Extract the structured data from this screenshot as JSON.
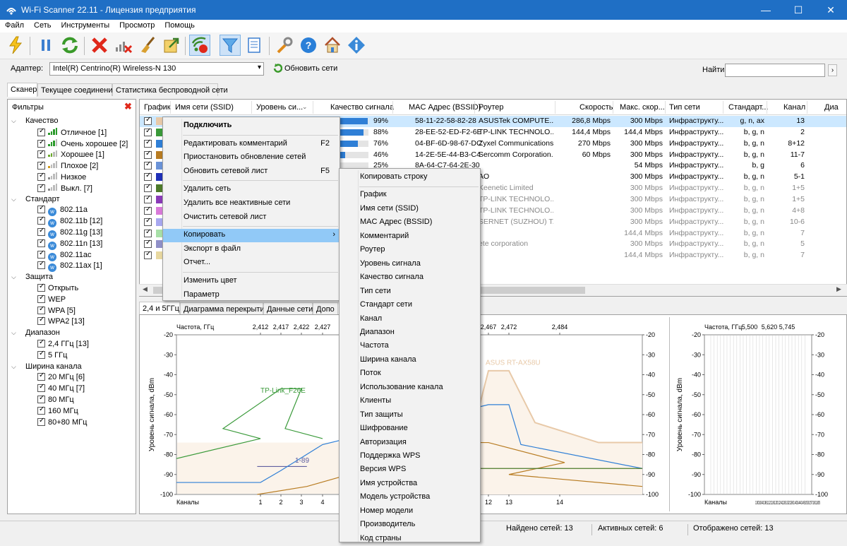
{
  "window": {
    "title": "Wi-Fi Scanner 22.11 - Лицензия предприятия",
    "minimize": "—",
    "maximize": "☐",
    "close": "✕"
  },
  "menu": [
    "Файл",
    "Сеть",
    "Инструменты",
    "Просмотр",
    "Помощь"
  ],
  "adapter": {
    "label": "Адаптер:",
    "value": "Intel(R) Centrino(R) Wireless-N 130",
    "refresh": "Обновить сети",
    "find_label": "Найти:",
    "find_value": ""
  },
  "main_tabs": [
    "Сканер",
    "Текущее соединение",
    "Статистика беспроводной сети"
  ],
  "filters": {
    "title": "Фильтры",
    "groups": [
      {
        "label": "Качество",
        "items": [
          "Отличное [1]",
          "Очень хорошее [2]",
          "Хорошее [1]",
          "Плохое [2]",
          "Низкое",
          "Выкл. [7]"
        ]
      },
      {
        "label": "Стандарт",
        "items": [
          "802.11a",
          "802.11b [12]",
          "802.11g [13]",
          "802.11n [13]",
          "802.11ac",
          "802.11ax [1]"
        ]
      },
      {
        "label": "Защита",
        "items": [
          "Открыть",
          "WEP",
          "WPA [5]",
          "WPA2 [13]"
        ]
      },
      {
        "label": "Диапазон",
        "items": [
          "2,4 ГГц [13]",
          "5 ГГц"
        ]
      },
      {
        "label": "Ширина канала",
        "items": [
          "20 МГц [6]",
          "40 МГц [7]",
          "80 МГц",
          "160 МГц",
          "80+80 МГц"
        ]
      }
    ]
  },
  "grid": {
    "columns": [
      "График",
      "Имя сети (SSID)",
      "Уровень си...",
      "Качество сигнала",
      "MAC Адрес (BSSID)",
      "Роутер",
      "Скорость",
      "Макс. скор...",
      "Тип сети",
      "Стандарт...",
      "Канал",
      "Диа"
    ],
    "rows": [
      {
        "color": "#e8c9a8",
        "quality": "99%",
        "q": 0.99,
        "mac": "58-11-22-58-82-28",
        "router": "ASUSTek COMPUTE...",
        "speed": "286,8 Mbps",
        "max": "300 Mbps",
        "type": "Инфраструкту...",
        "std": "g, n, ax",
        "ch": "13",
        "selected": true
      },
      {
        "color": "#3a9a3a",
        "quality": "88%",
        "q": 0.88,
        "mac": "28-EE-52-ED-F2-6E",
        "router": "TP-LINK TECHNOLO...",
        "speed": "144,4 Mbps",
        "max": "144,4 Mbps",
        "type": "Инфраструкту...",
        "std": "b, g, n",
        "ch": "2"
      },
      {
        "color": "#2f7fd6",
        "quality": "76%",
        "q": 0.76,
        "mac": "04-BF-6D-98-67-DC",
        "router": "Zyxel Communications ...",
        "speed": "270 Mbps",
        "max": "300 Mbps",
        "type": "Инфраструкту...",
        "std": "b, g, n",
        "ch": "8+12"
      },
      {
        "color": "#b87c22",
        "quality": "46%",
        "q": 0.46,
        "mac": "14-2E-5E-44-B3-C4",
        "router": "Sercomm Corporation.",
        "speed": "60 Mbps",
        "max": "300 Mbps",
        "type": "Инфраструкту...",
        "std": "b, g, n",
        "ch": "11-7"
      },
      {
        "color": "#6a93d8",
        "quality": "25%",
        "q": 0.25,
        "mac": "8A-64-C7-64-2E-30",
        "router": "",
        "speed": "",
        "max": "54 Mbps",
        "type": "Инфраструкту...",
        "std": "b, g",
        "ch": "6"
      },
      {
        "color": "#2030b8",
        "quality": "",
        "q": 0,
        "mac": "",
        "router": "AO",
        "speed": "",
        "max": "300 Mbps",
        "type": "Инфраструкту...",
        "std": "b, g, n",
        "ch": "5-1"
      },
      {
        "color": "#4d7a2a",
        "quality": "",
        "q": 0,
        "mac": "",
        "router": "Keenetic Limited",
        "speed": "",
        "max": "300 Mbps",
        "type": "Инфраструкту...",
        "std": "b, g, n",
        "ch": "1+5",
        "gray": true
      },
      {
        "color": "#8a3ab8",
        "quality": "",
        "q": 0,
        "mac": "",
        "router": "TP-LINK TECHNOLO...",
        "speed": "",
        "max": "300 Mbps",
        "type": "Инфраструкту...",
        "std": "b, g, n",
        "ch": "1+5",
        "gray": true
      },
      {
        "color": "#d97ad9",
        "quality": "",
        "q": 0,
        "mac": "",
        "router": "TP-LINK TECHNOLO...",
        "speed": "",
        "max": "300 Mbps",
        "type": "Инфраструкту...",
        "std": "b, g, n",
        "ch": "4+8",
        "gray": true
      },
      {
        "color": "#a8a8f0",
        "quality": "",
        "q": 0,
        "mac": "",
        "router": "SERNET (SUZHOU) T...",
        "speed": "",
        "max": "300 Mbps",
        "type": "Инфраструкту...",
        "std": "b, g, n",
        "ch": "10-6",
        "gray": true
      },
      {
        "color": "#a8e0a8",
        "quality": "",
        "q": 0,
        "mac": "",
        "router": "",
        "speed": "",
        "max": "144,4 Mbps",
        "type": "Инфраструкту...",
        "std": "b, g, n",
        "ch": "7",
        "gray": true
      },
      {
        "color": "#9090c8",
        "quality": "",
        "q": 0,
        "mac": "",
        "router": "ete corporation",
        "speed": "",
        "max": "300 Mbps",
        "type": "Инфраструкту...",
        "std": "b, g, n",
        "ch": "5",
        "gray": true
      },
      {
        "color": "#e8d8a0",
        "quality": "",
        "q": 0,
        "mac": "",
        "router": "",
        "speed": "",
        "max": "144,4 Mbps",
        "type": "Инфраструкту...",
        "std": "b, g, n",
        "ch": "7",
        "gray": true
      }
    ]
  },
  "bottom_tabs": [
    "2,4 и 5ГГц",
    "Диаграмма перекрытия",
    "Данные сети",
    "Допо"
  ],
  "chart_data": [
    {
      "type": "line",
      "title": "",
      "top_axis_label": "Частота, ГГц",
      "freq_ticks": [
        "2,412",
        "2,417",
        "2,422",
        "2,427",
        "2,467",
        "2,472",
        "2,484"
      ],
      "xlabel": "Каналы",
      "channel_ticks": [
        "1",
        "2",
        "3",
        "4",
        "12",
        "13",
        "14"
      ],
      "ylabel": "Уровень сигнала, dBm",
      "ylim": [
        -100,
        -20
      ],
      "yticks": [
        -20,
        -30,
        -40,
        -50,
        -60,
        -70,
        -80,
        -90,
        -100
      ],
      "labels": [
        "TP-Link_F26E",
        "1-89",
        "ASUS RT-AX58U"
      ],
      "series": [
        {
          "name": "TP-Link_F26E",
          "color": "#3a9a3a",
          "x": [
            0,
            1,
            1.5,
            2,
            3,
            3.5,
            4
          ],
          "y": [
            -82,
            -72,
            -67,
            -47,
            -47,
            -67,
            -72
          ]
        },
        {
          "name": "ASUS RT-AX58U",
          "color": "#e8c9a8",
          "x": [
            11,
            12,
            13,
            13.5,
            14.5,
            15
          ],
          "y": [
            -74,
            -38,
            -38,
            -64,
            -74,
            -74
          ]
        },
        {
          "name": "1-89",
          "color": "#6060a0",
          "x": [
            2.6,
            4.2
          ],
          "y": [
            -86,
            -86
          ]
        },
        {
          "color": "#2f7fd6",
          "x": [
            0,
            1,
            2,
            4,
            12,
            13,
            13.3,
            15
          ],
          "y": [
            -94,
            -94,
            -88,
            -75,
            -55,
            -55,
            -75,
            -87
          ]
        },
        {
          "color": "#b87c22",
          "x": [
            2.6,
            4.2,
            10,
            12,
            12.5,
            13,
            15
          ],
          "y": [
            -100,
            -96,
            -74,
            -74,
            -84,
            -90,
            -96
          ]
        },
        {
          "color": "#4d7a2a",
          "x": [
            10,
            15
          ],
          "y": [
            -87,
            -87
          ]
        }
      ]
    },
    {
      "type": "line",
      "title": "",
      "top_axis_label": "Частота, ГГц",
      "freq_ticks": [
        "5,500",
        "5,620",
        "5,745"
      ],
      "xlabel": "Каналы",
      "channel_ticks_text": "100104108112116120124128132136140144149153157161165",
      "ylabel": "Уровень сигнала, dBm",
      "ylim": [
        -100,
        -20
      ],
      "yticks": [
        -20,
        -30,
        -40,
        -50,
        -60,
        -70,
        -80,
        -90,
        -100
      ],
      "series": []
    }
  ],
  "context_menu": {
    "items": [
      {
        "label": "Подключить",
        "bold": true
      },
      {
        "sep": true
      },
      {
        "label": "Редактировать комментарий",
        "shortcut": "F2"
      },
      {
        "label": "Приостановить обновление сетей"
      },
      {
        "label": "Обновить сетевой лист",
        "shortcut": "F5"
      },
      {
        "sep": true
      },
      {
        "label": "Удалить сеть"
      },
      {
        "label": "Удалить все неактивные сети"
      },
      {
        "label": "Очистить сетевой лист"
      },
      {
        "sep": true
      },
      {
        "label": "Копировать",
        "submenu": true,
        "highlight": true
      },
      {
        "label": "Экспорт в файл"
      },
      {
        "label": "Отчет..."
      },
      {
        "sep": true
      },
      {
        "label": "Изменить цвет"
      },
      {
        "label": "Параметр"
      }
    ]
  },
  "copy_submenu": {
    "items": [
      "Копировать строку",
      "-",
      "График",
      "Имя сети (SSID)",
      "MAC Адрес (BSSID)",
      "Комментарий",
      "Роутер",
      "Уровень сигнала",
      "Качество сигнала",
      "Тип сети",
      "Стандарт сети",
      "Канал",
      "Диапазон",
      "Частота",
      "Ширина канала",
      "Поток",
      "Использование канала",
      "Клиенты",
      "Тип защиты",
      "Шифрование",
      "Авторизация",
      "Поддержка WPS",
      "Версия WPS",
      "Имя устройства",
      "Модель устройства",
      "Номер модели",
      "Производитель",
      "Код страны"
    ]
  },
  "status": {
    "found": "Найдено сетей: 13",
    "active": "Активных сетей: 6",
    "shown": "Отображено сетей: 13"
  },
  "colors": {
    "titlebar": "#1f6fc5",
    "selection": "#cce8ff",
    "menu_highlight": "#91c9f7",
    "quality_bar": "#2f7fd6"
  }
}
